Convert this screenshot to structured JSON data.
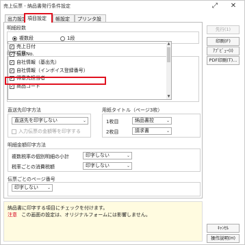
{
  "window": {
    "title": "売上伝票 - 納品書発行条件設定",
    "expand_glyph": "⤢",
    "close_glyph": "✕"
  },
  "tabs": [
    {
      "label": "出力設定",
      "active": false
    },
    {
      "label": "項目設定",
      "active": true
    },
    {
      "label": "帳設定",
      "active": false
    },
    {
      "label": "プリンタ設定",
      "active": false
    }
  ],
  "meisai_dansu": {
    "title": "明細段数",
    "options": [
      {
        "label": "複数段",
        "selected": true
      },
      {
        "label": "1段",
        "selected": false
      }
    ]
  },
  "print_items": {
    "title": "印字項目",
    "items": [
      {
        "label": "売上日付",
        "checked": true
      },
      {
        "label": "伝票No.",
        "checked": true
      },
      {
        "label": "自社情報（基出先）",
        "checked": true
      },
      {
        "label": "自社情報（インボイス登録番号）",
        "checked": true
      },
      {
        "label": "得意先担当者",
        "checked": true
      },
      {
        "label": "商品コード",
        "checked": true
      }
    ]
  },
  "chokusosaki": {
    "title": "直送先印字方法",
    "select_value": "直送先を印字しない",
    "checkbox_label": "入力伝票の金額等を印字する",
    "checkbox_checked": false
  },
  "yoshi_title": {
    "title": "用紙タイトル（ページ3枚）",
    "rows": [
      {
        "label": "1枚目",
        "value": "納品書控"
      },
      {
        "label": "2枚目",
        "value": "請求書"
      }
    ]
  },
  "meisai_kingaku": {
    "title": "明細金額印字方法",
    "rows": [
      {
        "label": "複数税率の個別明細の小計",
        "value": "印字しない"
      },
      {
        "label": "税率ごとの消費税額",
        "value": "印字しない"
      }
    ]
  },
  "page_no": {
    "title": "伝票ごとのページ番号",
    "value": "印字しない"
  },
  "buttons": {
    "first": "先行(1)",
    "print": "印刷(F)",
    "preview": "ｱﾌﾟﾋﾞｭｰ(I)",
    "pdf": "PDF印刷(T)...",
    "cancel": "ｷｬﾝｾﾙ",
    "help": "操作説明(H)"
  },
  "note": {
    "line1": "納品書に印字する項目にチェックを付けます。",
    "line2_label": "注意",
    "line2_text": "この画面の設定は、オリジナルフォームには影響しません。"
  },
  "colors": {
    "highlight": "#e0101e",
    "note_bg": "#fffbe0"
  }
}
